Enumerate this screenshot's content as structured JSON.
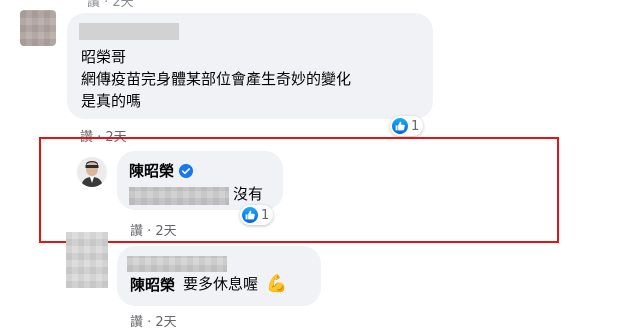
{
  "comments": [
    {
      "text_line1": "昭榮哥",
      "text_line2": "網傳疫苗完身體某部位會產生奇妙的變化",
      "text_line3": "是真的嗎",
      "actions": "讚 · 2天",
      "reactions": "1",
      "top_meta": "讚 · 2天"
    },
    {
      "author": "陳昭榮",
      "text_suffix": "沒有",
      "actions": "讚 · 2天",
      "reactions": "1"
    },
    {
      "author": "陳昭榮",
      "text": "要多休息喔",
      "emoji": "💪",
      "actions": "讚 · 2天"
    }
  ],
  "colors": {
    "highlight_box": "#e01515",
    "bubble_bg": "#f0f2f5",
    "verified": "#1877f2",
    "like": "#1877f2"
  },
  "icons": [
    "like-icon",
    "verified-badge-icon",
    "flexed-biceps-emoji"
  ]
}
